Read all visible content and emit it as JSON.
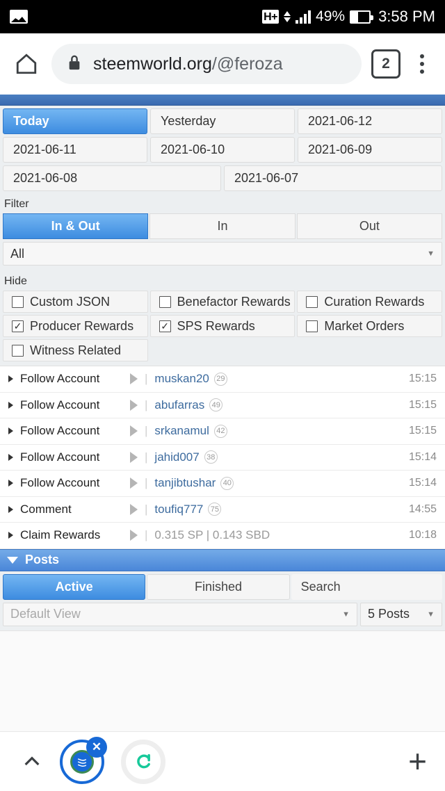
{
  "status_bar": {
    "image_icon": "photo-icon",
    "network_type": "H+",
    "data_arrows_icon": "data-transfer-icon",
    "signal_icon": "signal-bars-icon",
    "battery_percent": "49%",
    "battery_icon": "battery-icon",
    "time": "3:58 PM"
  },
  "browser": {
    "home_icon": "home-icon",
    "lock_icon": "lock-icon",
    "url_main": "steemworld.org",
    "url_path": "/@feroza",
    "tab_count": "2",
    "menu_icon": "kebab-menu-icon"
  },
  "date_tabs": [
    {
      "label": "Today",
      "active": true
    },
    {
      "label": "Yesterday",
      "active": false
    },
    {
      "label": "2021-06-12",
      "active": false
    },
    {
      "label": "2021-06-11",
      "active": false
    },
    {
      "label": "2021-06-10",
      "active": false
    },
    {
      "label": "2021-06-09",
      "active": false
    },
    {
      "label": "2021-06-08",
      "active": false
    },
    {
      "label": "2021-06-07",
      "active": false
    }
  ],
  "filter": {
    "section_label": "Filter",
    "options": [
      {
        "label": "In & Out",
        "active": true
      },
      {
        "label": "In",
        "active": false
      },
      {
        "label": "Out",
        "active": false
      }
    ],
    "type_select_value": "All",
    "caret_icon": "chevron-down-icon"
  },
  "hide": {
    "section_label": "Hide",
    "items": [
      {
        "label": "Custom JSON",
        "checked": false
      },
      {
        "label": "Benefactor Rewards",
        "checked": false
      },
      {
        "label": "Curation Rewards",
        "checked": false
      },
      {
        "label": "Producer Rewards",
        "checked": true
      },
      {
        "label": "SPS Rewards",
        "checked": true
      },
      {
        "label": "Market Orders",
        "checked": false
      },
      {
        "label": "Witness Related",
        "checked": false
      }
    ]
  },
  "transactions": [
    {
      "operation": "Follow Account",
      "account": "muskan20",
      "reputation": "29",
      "amount": "",
      "time": "15:15"
    },
    {
      "operation": "Follow Account",
      "account": "abufarras",
      "reputation": "49",
      "amount": "",
      "time": "15:15"
    },
    {
      "operation": "Follow Account",
      "account": "srkanamul",
      "reputation": "42",
      "amount": "",
      "time": "15:15"
    },
    {
      "operation": "Follow Account",
      "account": "jahid007",
      "reputation": "38",
      "amount": "",
      "time": "15:14"
    },
    {
      "operation": "Follow Account",
      "account": "tanjibtushar",
      "reputation": "40",
      "amount": "",
      "time": "15:14"
    },
    {
      "operation": "Comment",
      "account": "toufiq777",
      "reputation": "75",
      "amount": "",
      "time": "14:55"
    },
    {
      "operation": "Claim Rewards",
      "account": "",
      "reputation": "",
      "amount": "0.315 SP  |  0.143 SBD",
      "time": "10:18"
    }
  ],
  "posts_panel": {
    "title": "Posts",
    "collapse_icon": "triangle-down-icon",
    "tabs": [
      {
        "label": "Active",
        "active": true
      },
      {
        "label": "Finished",
        "active": false
      }
    ],
    "search_placeholder": "Search",
    "view_select_value": "Default View",
    "count_select_value": "5 Posts"
  },
  "bottom_nav": {
    "expand_icon": "chevron-up-icon",
    "tab_steem_icon": "steem-logo-icon",
    "tab_steem_close_icon": "close-icon",
    "tab_second_icon": "refresh-circle-icon",
    "add_icon": "plus-icon"
  },
  "colors": {
    "accent_blue": "#3d8ce0",
    "header_blue": "#4a7fc1",
    "link_blue": "#3d6b9e",
    "page_bg": "#eceff1",
    "teal": "#17c99a"
  }
}
